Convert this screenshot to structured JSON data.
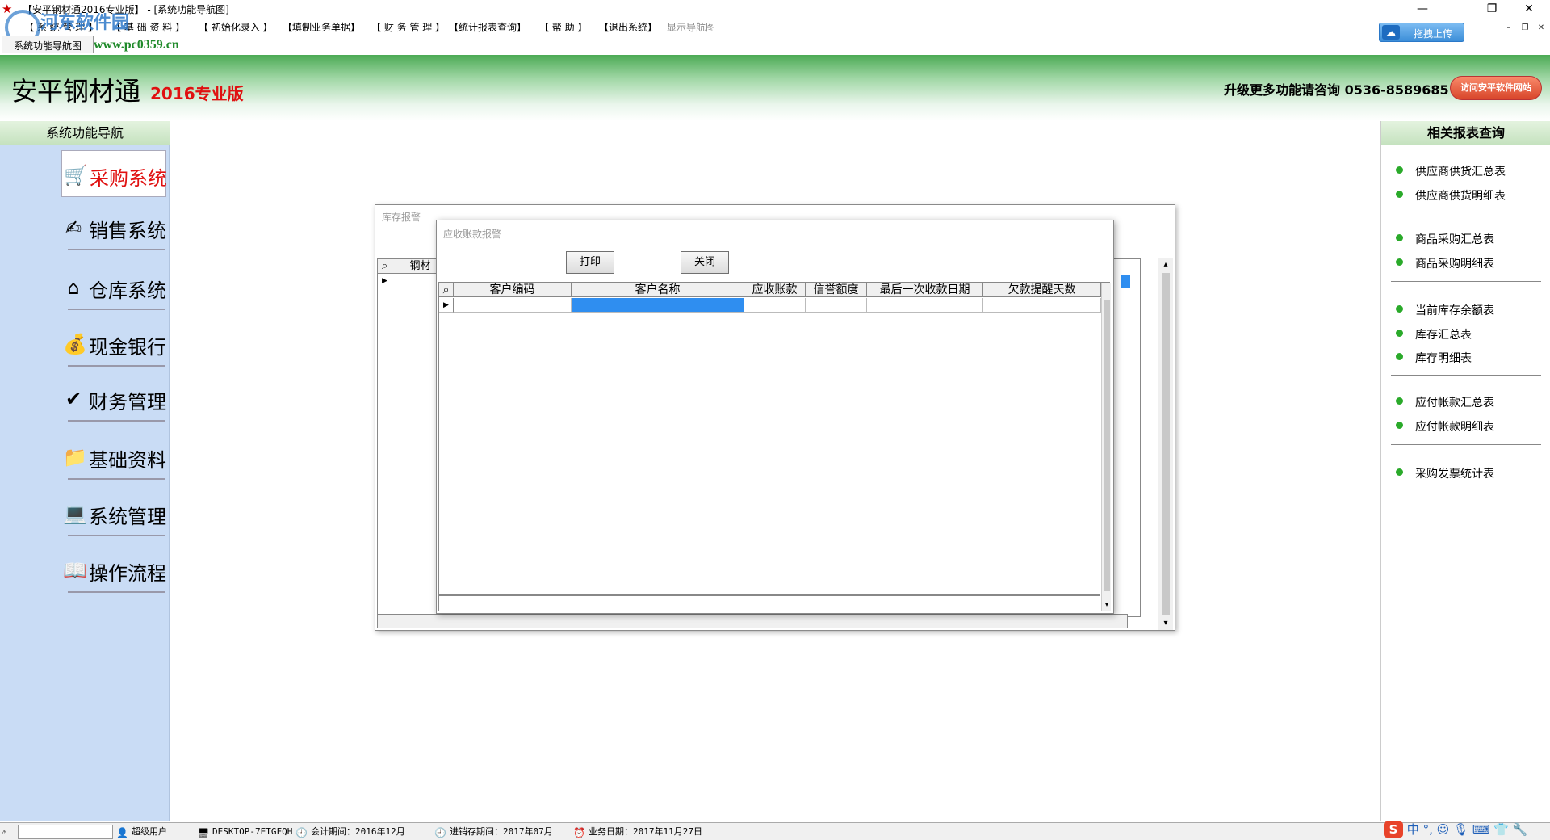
{
  "window": {
    "title": "【安平钢材通2016专业版】 - [系统功能导航图]",
    "minimize_glyph": "—",
    "maximize_glyph": "❐",
    "close_glyph": "✕"
  },
  "menu": [
    "【 系 统 管 理 】",
    "【 基 础 资 料 】",
    "【 初始化录入 】",
    "【填制业务单据】",
    "【 财 务 管 理 】",
    "【统计报表查询】",
    "【 帮 助 】",
    "【退出系统】",
    "显示导航图"
  ],
  "upload_button": {
    "label": "拖拽上传",
    "icon": "cloud-icon"
  },
  "watermark": {
    "site_name": "河东软件园",
    "url": "www.pc0359.cn"
  },
  "document_tab": "系统功能导航图",
  "header": {
    "app_name": "安平钢材通",
    "edition": "2016专业版",
    "promo": "升级更多功能请咨询 0536-8589685",
    "visit_button": "访问安平软件网站"
  },
  "left_nav": {
    "title": "系统功能导航",
    "items": [
      {
        "label": "采购系统",
        "icon": "purchase-icon",
        "active": true
      },
      {
        "label": "销售系统",
        "icon": "sales-icon",
        "active": false
      },
      {
        "label": "仓库系统",
        "icon": "warehouse-icon",
        "active": false
      },
      {
        "label": "现金银行",
        "icon": "cash-bank-icon",
        "active": false
      },
      {
        "label": "财务管理",
        "icon": "finance-icon",
        "active": false
      },
      {
        "label": "基础资料",
        "icon": "basic-data-icon",
        "active": false
      },
      {
        "label": "系统管理",
        "icon": "system-admin-icon",
        "active": false
      },
      {
        "label": "操作流程",
        "icon": "workflow-icon",
        "active": false
      }
    ]
  },
  "right_panel": {
    "title": "相关报表查询",
    "groups": [
      [
        "供应商供货汇总表",
        "供应商供货明细表"
      ],
      [
        "商品采购汇总表",
        "商品采购明细表"
      ],
      [
        "当前库存余额表",
        "库存汇总表",
        "库存明细表"
      ],
      [
        "应付帐款汇总表",
        "应付帐款明细表"
      ],
      [
        "采购发票统计表"
      ]
    ]
  },
  "back_window": {
    "title": "库存报警",
    "columns": [
      "钢材"
    ]
  },
  "dialog": {
    "title": "应收账款报警",
    "print_button": "打印",
    "close_button": "关闭",
    "columns": [
      "客户编码",
      "客户名称",
      "应收账款",
      "信誉额度",
      "最后一次收款日期",
      "欠款提醒天数"
    ],
    "rows": [
      [
        "",
        "",
        "",
        "",
        "",
        ""
      ]
    ]
  },
  "status_bar": {
    "user": "超级用户",
    "computer": "DESKTOP-7ETGFQH",
    "accounting_period": "会计期间：2016年12月",
    "inventory_period": "进销存期间：2017年07月",
    "business_date": "业务日期：2017年11月27日"
  },
  "ime_bar": {
    "logo": "S",
    "mode": "中",
    "punct": "°,"
  }
}
